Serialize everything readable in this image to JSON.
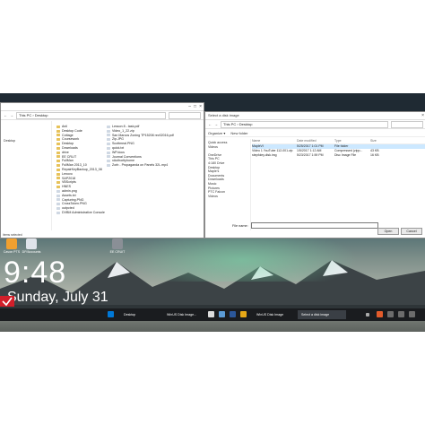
{
  "explorer": {
    "title": "",
    "address": "This PC › Desktop",
    "nav_items": [
      "",
      "",
      "",
      "",
      "Desktop",
      "",
      "",
      "",
      "",
      "",
      "",
      "",
      "",
      "",
      "",
      "",
      "",
      "",
      "",
      "",
      ""
    ],
    "col1": [
      "Anil",
      "Desktop Code",
      "Cottage",
      "Coursework",
      "Desktop",
      "Downloads",
      "drive",
      "EE CRLIT",
      "FullMan",
      "FullMan 2013_10",
      "RepairKeyBackup_2013_08",
      "Lenovo",
      "SAP2018",
      "VBScripts",
      "HNES",
      "admin.png",
      "Assets.txt",
      "Capturing.PNG",
      "CrossToken.PNG",
      "outpcted",
      "DVBM Administrative Console"
    ],
    "col2": [
      "Lesson 8 - task.pdf",
      "Video_1_22.zip",
      "San Marcos Zoning TP15208 rev02016.pdf",
      "Zip.JPG",
      "Scottmeal.PNG",
      "quick.txt",
      "WP.docs",
      "Journal Conventions",
      "xAuthorityhome",
      "Zorb - Propaganda on Panels 32L.mp4"
    ],
    "status": "items selected"
  },
  "dialog": {
    "title": "Select a disk image",
    "address": "This PC › Desktop",
    "toolbar": [
      "Organize ▾",
      "New folder"
    ],
    "headers": [
      "Name",
      "Date modified",
      "Type",
      "Size"
    ],
    "nav_items": [
      "Quick access",
      "Videos",
      "",
      "OneDrive",
      "This PC",
      "4:180 Drive",
      "Desktop",
      "Maple's",
      "Documents",
      "Downloads",
      "Music",
      "Pictures",
      "PTC Falcon",
      "Videos"
    ],
    "files": [
      {
        "name": "MapleVI",
        "date": "5/25/2017 1:01 PM",
        "type": "File folder",
        "size": ""
      },
      {
        "name": "Video 1 YouTube 112-001.zip",
        "date": "1/5/2017 1:12 AM",
        "type": "Compressed (zipp...",
        "size": "43 KB"
      },
      {
        "name": "stepfoley.disk.img",
        "date": "5/23/2017 1:59 PM",
        "type": "Disc Image File",
        "size": "16 KB"
      }
    ],
    "filename_label": "File name:",
    "filter_value": "",
    "open_label": "Open",
    "cancel_label": "Cancel"
  },
  "desktop_icons": [
    {
      "label": "Cavon PTS"
    },
    {
      "label": "DP/Accounts"
    },
    {
      "label": "EE CRUIT"
    }
  ],
  "lockscreen": {
    "time": "9:48",
    "date": "Sunday, July 31"
  },
  "taskbar": {
    "items": [
      "Desktop",
      "WinUS Disk Image...",
      "WinUS Disk Image",
      "Select a disk image"
    ]
  },
  "colors": {
    "accent": "#0078d7",
    "taskbar": "#1a1c1f",
    "folder": "#e7c25a",
    "selection": "#cce8ff"
  }
}
